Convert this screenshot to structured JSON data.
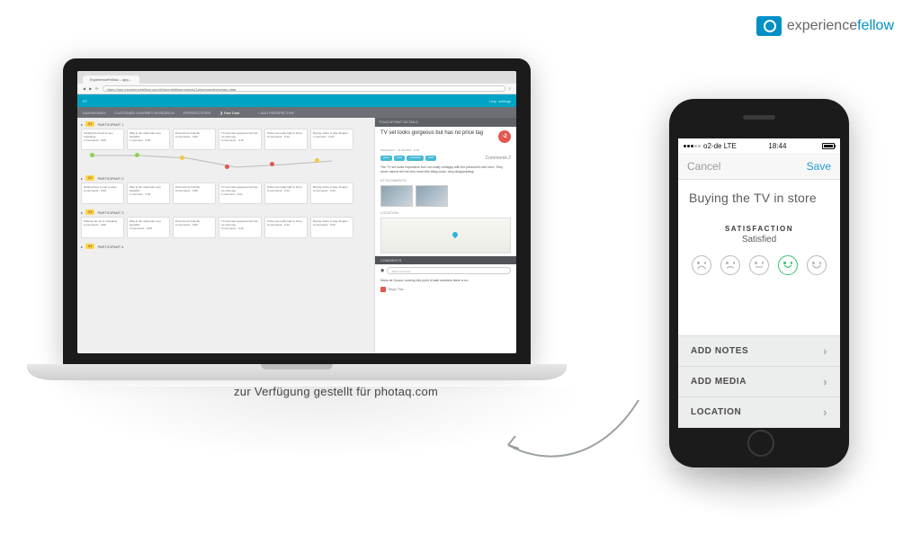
{
  "brand": {
    "name_light": "experience",
    "name_bold": "fellow",
    "accent": "#0090c6"
  },
  "watermark": "zur Verfügung gestellt für photaq.com",
  "browser": {
    "tab_title": "ExperienceFellow – app…",
    "url": "https://app.experiencefellow.com/#!/storytelling/projects/1a/perspectives/raw-data"
  },
  "app": {
    "top": {
      "left": "EF",
      "right_links": [
        "help",
        "settings"
      ]
    },
    "subnav": {
      "items": [
        "DASHBOARD",
        "CUSTOMER JOURNEY RESEARCH",
        "PERSPECTIVES"
      ],
      "breadcrumb": "Raw Data",
      "right": "+ ADD PERSPECTIVE"
    },
    "lanes": [
      {
        "tag": "01",
        "name": "PARTICIPANT 1",
        "cards": [
          {
            "title": "Finding the brand is very frustrating",
            "meta": "2 comments · 0:00"
          },
          {
            "title": "Way to the mall looks very beautiful",
            "meta": "1 comment · 0:03"
          },
          {
            "title": "Personnel is friendly",
            "meta": "0 comments · 0:06"
          },
          {
            "title": "TV set looks gorgeous but has no price tag",
            "meta": "2 comments · 0:10"
          },
          {
            "title": "Prices are really high in shop",
            "meta": "0 comments · 0:14"
          },
          {
            "title": "Buying online is way cheaper",
            "meta": "1 comment · 0:20"
          }
        ],
        "mood": [
          2,
          2,
          1,
          -2,
          -1,
          0
        ]
      },
      {
        "tag": "02",
        "name": "PARTICIPANT 2",
        "cards": [
          {
            "title": "Getting there by car is easy",
            "meta": "0 comments · 0:00"
          },
          {
            "title": "Way to the mall looks very beautiful",
            "meta": "1 comment · 0:03"
          },
          {
            "title": "Personnel is friendly",
            "meta": "0 comments · 0:06"
          },
          {
            "title": "TV set looks gorgeous but has no price tag",
            "meta": "1 comment · 0:10"
          },
          {
            "title": "Prices are really high in shop",
            "meta": "0 comments · 0:14"
          },
          {
            "title": "Buying online is way cheaper",
            "meta": "0 comments · 0:20"
          }
        ]
      },
      {
        "tag": "03",
        "name": "PARTICIPANT 3",
        "cards": [
          {
            "title": "Parking the car is frustrating",
            "meta": "0 comments · 0:00"
          },
          {
            "title": "Way to the mall looks very beautiful",
            "meta": "0 comments · 0:03"
          },
          {
            "title": "Personnel is friendly",
            "meta": "0 comments · 0:06"
          },
          {
            "title": "TV set looks gorgeous but has no price tag",
            "meta": "0 comments · 0:10"
          },
          {
            "title": "Prices are really high in shop",
            "meta": "0 comments · 0:14"
          },
          {
            "title": "Buying online is way cheaper",
            "meta": "0 comments · 0:20"
          }
        ]
      },
      {
        "tag": "04",
        "name": "PARTICIPANT 4",
        "cards": []
      }
    ],
    "details": {
      "panel_label": "TOUCHPOINT DETAILS",
      "title": "TV set looks gorgeous but has no price tag",
      "score": "-2",
      "meta": "Participant 1 · 21.08.2014 · 0:10",
      "tags": [
        "store",
        "price",
        "confusion",
        "staff"
      ],
      "comments_count": "Comments 2",
      "description": "The TV set looks impressive but I am really unhappy with the personnel over here. They never cannot tell me how much this thing costs. Very disappointing!",
      "attachments_label": "ATTACHMENTS",
      "location_label": "LOCATION",
      "comments_label": "COMMENTS",
      "add_comment_placeholder": "Add a comment",
      "comment_text": "Maria de Souza: Looking into point of sale numbers there is no…",
      "reply_label": "Reply This"
    }
  },
  "phone": {
    "status": {
      "carrier": "o2-de",
      "net": "LTE",
      "time": "18:44"
    },
    "nav": {
      "cancel": "Cancel",
      "save": "Save"
    },
    "title": "Buying the TV in store",
    "satisfaction": {
      "label": "SATISFACTION",
      "value": "Satisfied",
      "selected_index": 3
    },
    "actions": [
      "ADD NOTES",
      "ADD MEDIA",
      "LOCATION"
    ]
  }
}
